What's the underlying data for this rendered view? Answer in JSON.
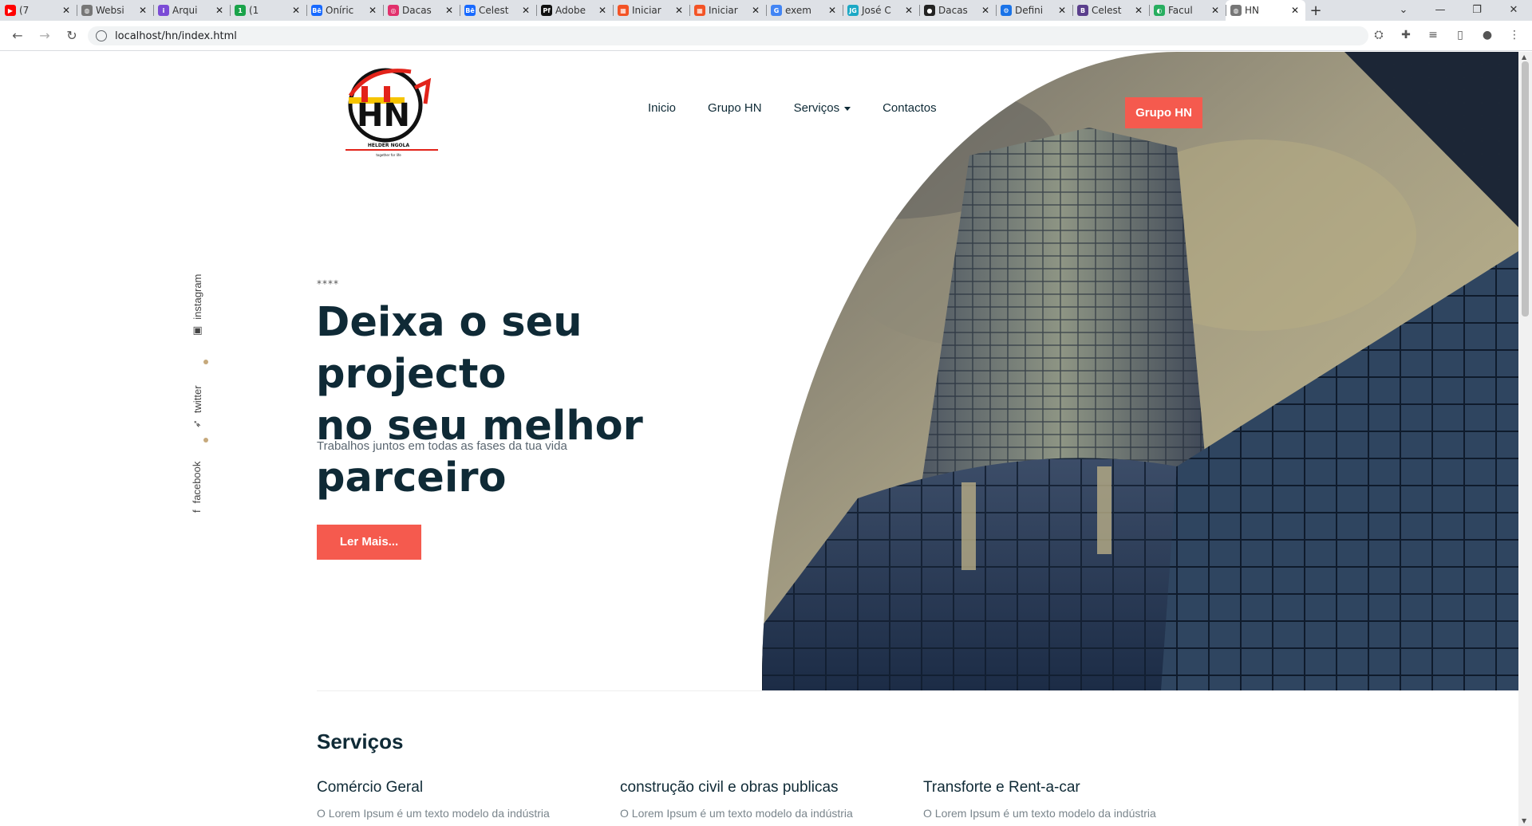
{
  "browser": {
    "tabs": [
      {
        "title": "(7",
        "fav": "red"
      },
      {
        "title": "Websi",
        "fav": "#777"
      },
      {
        "title": "Arqui",
        "fav": "#7b4bd6"
      },
      {
        "title": "(1",
        "fav": "#1aa34a"
      },
      {
        "title": "Oníric",
        "fav": "#1769ff"
      },
      {
        "title": "Dacas",
        "fav": "#e1306c"
      },
      {
        "title": "Celest",
        "fav": "#1769ff"
      },
      {
        "title": "Adobe",
        "fav": "#111"
      },
      {
        "title": "Iniciar",
        "fav": "#f35325"
      },
      {
        "title": "Iniciar",
        "fav": "#f35325"
      },
      {
        "title": "exem",
        "fav": "#4285f4"
      },
      {
        "title": "José C",
        "fav": "#1ba8c5"
      },
      {
        "title": "Dacas",
        "fav": "#222"
      },
      {
        "title": "Defini",
        "fav": "#1a73e8"
      },
      {
        "title": "Celest",
        "fav": "#5a3e8c"
      },
      {
        "title": "Facul",
        "fav": "#27ae60"
      },
      {
        "title": "HN",
        "fav": "#777"
      }
    ],
    "url": "localhost/hn/index.html"
  },
  "nav": {
    "links": [
      "Inicio",
      "Grupo HN",
      "Serviços",
      "Contactos"
    ],
    "cta": "Grupo HN"
  },
  "logo": {
    "name": "HELDER NGOLA",
    "tagline": "together for life"
  },
  "social": [
    "instagram",
    "twitter",
    "facebook"
  ],
  "hero": {
    "eyebrow": "****",
    "headline_1": "Deixa o seu projecto",
    "headline_2": "no seu melhor",
    "headline_3": "parceiro",
    "subtitle": "Trabalhos juntos em todas as fases da tua vida",
    "cta": "Ler Mais..."
  },
  "services": {
    "title": "Serviços",
    "items": [
      {
        "title": "Comércio Geral",
        "text": "O Lorem Ipsum é um texto modelo da indústria"
      },
      {
        "title": "construção civil e obras publicas",
        "text": "O Lorem Ipsum é um texto modelo da indústria"
      },
      {
        "title": "Transforte e Rent-a-car",
        "text": "O Lorem Ipsum é um texto modelo da indústria"
      }
    ]
  },
  "colors": {
    "accent": "#f55a4e",
    "navy": "#0f2a36",
    "dot": "#c6a97c"
  }
}
